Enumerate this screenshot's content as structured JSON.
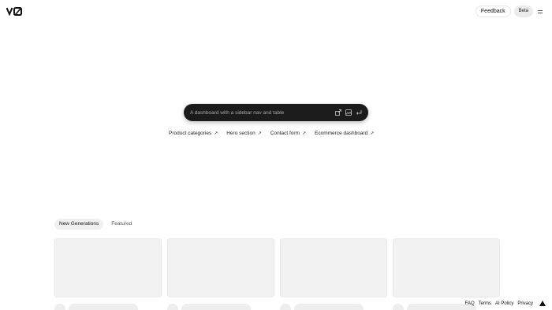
{
  "header": {
    "logo_icon": "v0-logo-icon",
    "feedback_label": "Feedback",
    "beta_label": "Beta",
    "menu_icon": "hamburger-menu-icon"
  },
  "prompt": {
    "placeholder": "A dashboard with a sidebar nav and table",
    "icons": [
      "upload-icon",
      "image-icon",
      "enter-icon"
    ]
  },
  "suggestions": [
    {
      "label": "Product categories",
      "icon": "arrow-up-right-icon"
    },
    {
      "label": "Hero section",
      "icon": "arrow-up-right-icon"
    },
    {
      "label": "Contact form",
      "icon": "arrow-up-right-icon"
    },
    {
      "label": "Ecommerce dashboard",
      "icon": "arrow-up-right-icon"
    }
  ],
  "tabs": [
    {
      "label": "New Generations",
      "active": true
    },
    {
      "label": "Featured",
      "active": false
    }
  ],
  "footer": {
    "links": [
      "FAQ",
      "Terms",
      "AI Policy",
      "Privacy"
    ],
    "brand_icon": "vercel-triangle-icon"
  }
}
